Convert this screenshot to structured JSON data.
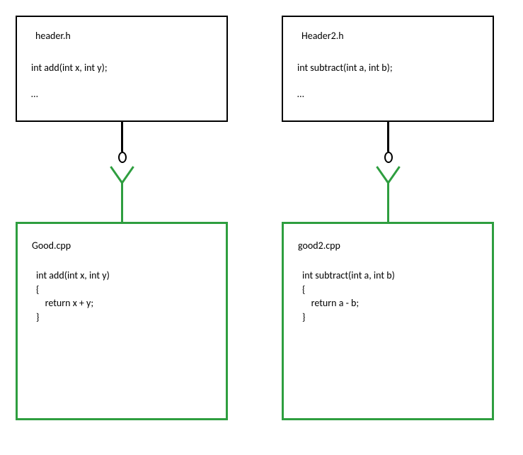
{
  "left": {
    "header": {
      "filename": "header.h",
      "declaration": "int add(int x, int y);",
      "ellipsis": "…"
    },
    "impl": {
      "filename": "Good.cpp",
      "code": "int add(int x, int y)\n{\n    return x + y;\n}"
    }
  },
  "right": {
    "header": {
      "filename": "Header2.h",
      "declaration": "int subtract(int a, int b);",
      "ellipsis": "…"
    },
    "impl": {
      "filename": "good2.cpp",
      "code": "int subtract(int a, int b)\n{\n    return a - b;\n}"
    }
  }
}
